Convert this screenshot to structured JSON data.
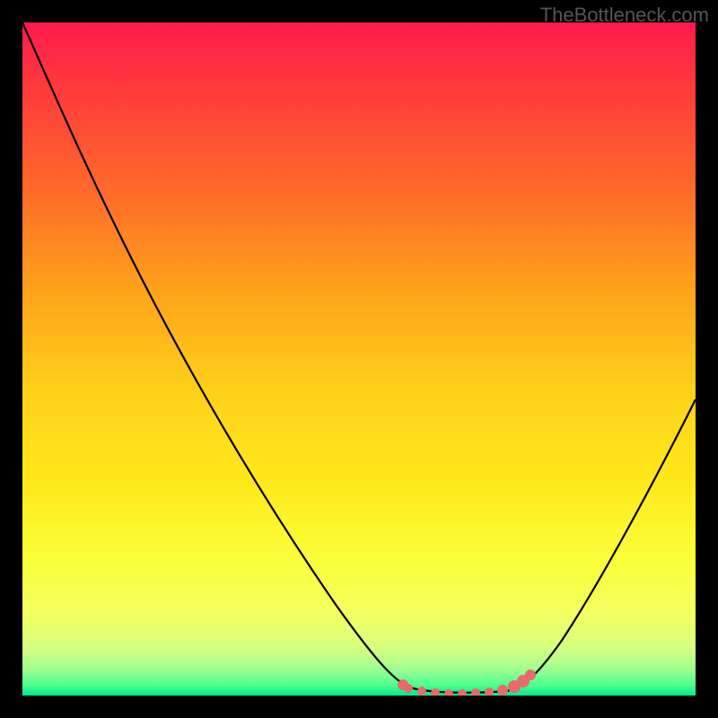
{
  "watermark": "TheBottleneck.com",
  "chart_data": {
    "type": "line",
    "title": "",
    "xlabel": "",
    "ylabel": "",
    "xlim": [
      0,
      100
    ],
    "ylim": [
      0,
      100
    ],
    "series": [
      {
        "name": "bottleneck-curve",
        "x": [
          0,
          10,
          20,
          30,
          40,
          50,
          58,
          62,
          66,
          70,
          74,
          80,
          90,
          100
        ],
        "y": [
          100,
          82,
          64,
          46,
          29,
          12,
          1,
          0,
          0,
          0,
          1,
          8,
          25,
          45
        ]
      }
    ],
    "highlight": {
      "name": "optimal-zone",
      "x_range": [
        57,
        75
      ],
      "y": 0
    },
    "gradient_stops": [
      {
        "pos": 0,
        "color": "#ff1a4d"
      },
      {
        "pos": 25,
        "color": "#ff6a2a"
      },
      {
        "pos": 55,
        "color": "#ffd11a"
      },
      {
        "pos": 80,
        "color": "#faff3a"
      },
      {
        "pos": 100,
        "color": "#00e88a"
      }
    ]
  }
}
